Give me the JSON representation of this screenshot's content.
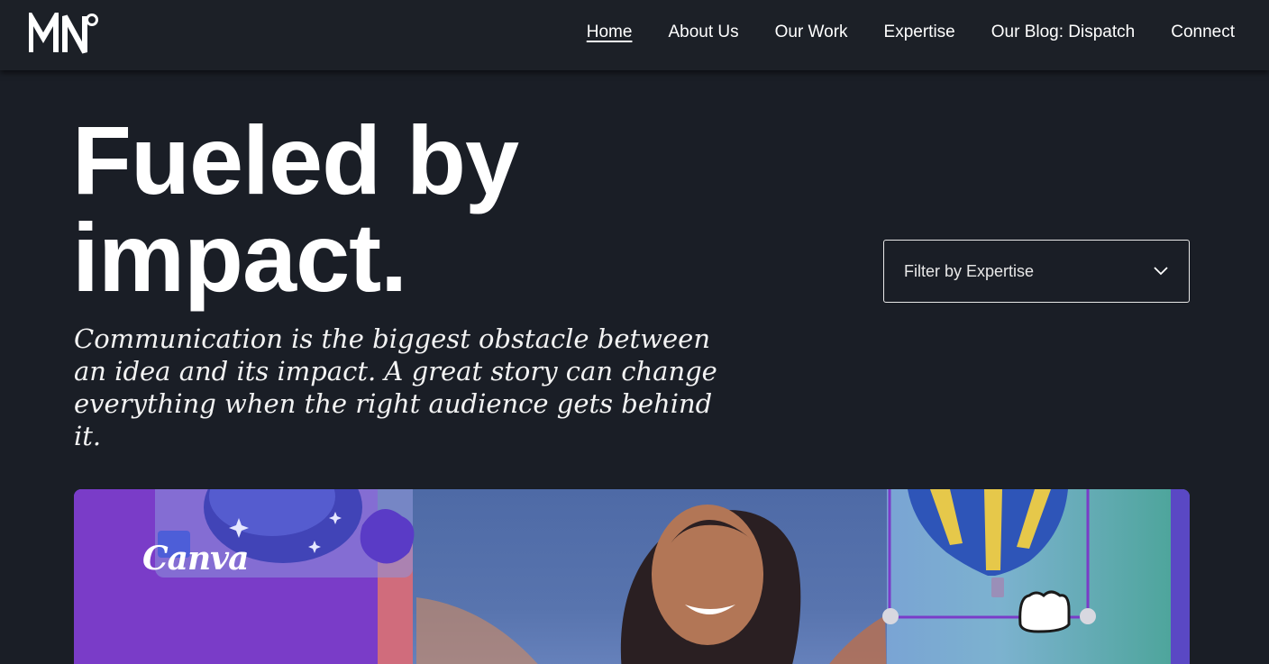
{
  "header": {
    "logo_text": "MN°",
    "nav": [
      {
        "label": "Home",
        "active": true
      },
      {
        "label": "About Us",
        "active": false
      },
      {
        "label": "Our Work",
        "active": false
      },
      {
        "label": "Expertise",
        "active": false
      },
      {
        "label": "Our Blog: Dispatch",
        "active": false
      },
      {
        "label": "Connect",
        "active": false
      }
    ]
  },
  "hero": {
    "headline_line1": "Fueled by",
    "headline_line2": "impact.",
    "subhead": "Communication is the biggest obstacle between an idea and its impact. A great story can change everything when the right audience gets behind it."
  },
  "filter": {
    "label": "Filter by Expertise",
    "icon": "chevron-down-icon"
  },
  "feature_card": {
    "brand": "Canva"
  },
  "colors": {
    "background": "#1a1e26",
    "header": "#1c2027",
    "card_purple": "#7a3cc8",
    "text": "#ffffff"
  }
}
